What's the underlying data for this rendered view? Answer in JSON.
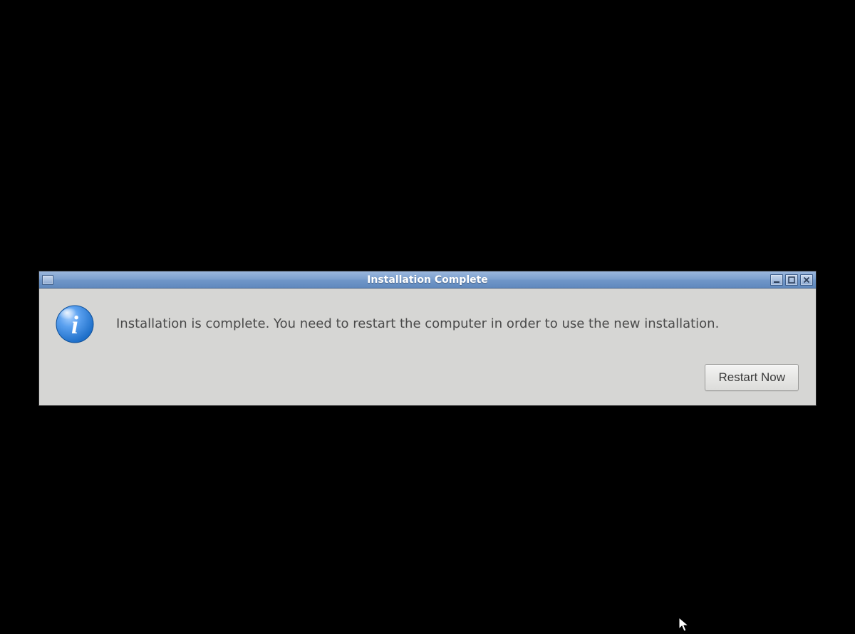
{
  "dialog": {
    "title": "Installation Complete",
    "message": "Installation is complete. You need to restart the computer in order to use the new installation.",
    "restart_button_label": "Restart Now"
  }
}
